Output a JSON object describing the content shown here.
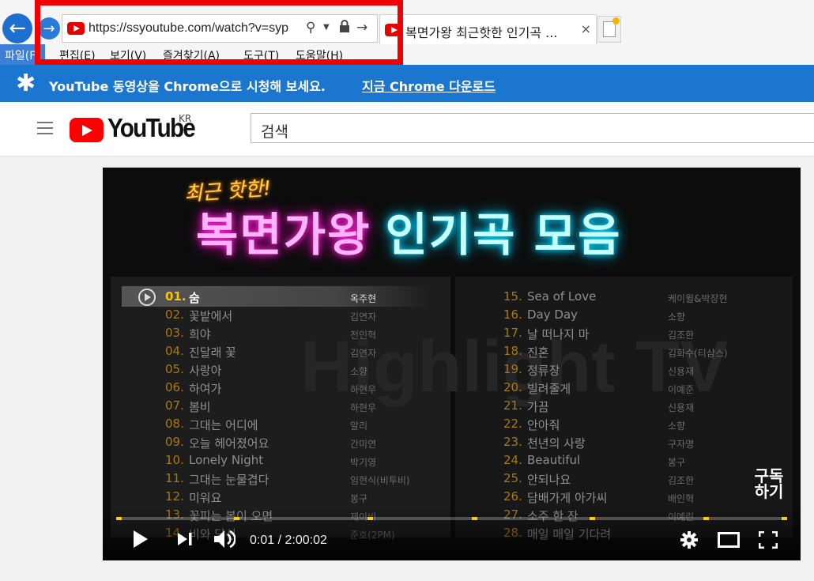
{
  "browser": {
    "address_url": "https://ssyoutube.com/watch?v=syp",
    "tab_title": "복면가왕 최근핫한 인기곡 ...",
    "tab_close": "×",
    "menu": [
      "파일(F)",
      "편집(E)",
      "보기(V)",
      "즐겨찾기(A)",
      "도구(T)",
      "도움말(H)"
    ]
  },
  "banner": {
    "text": "YouTube 동영상을 Chrome으로 시청해 보세요.",
    "link": "지금 Chrome 다운로드"
  },
  "youtube": {
    "logo": "YouTube",
    "region": "KR",
    "search_placeholder": "검색"
  },
  "video": {
    "title_small": "최근 핫한!",
    "title_a": "복면가왕",
    "title_b": "인기곡 모음",
    "watermark": "Highlight TV",
    "subscribe": "구독\n하기",
    "time": "0:01 / 2:00:02",
    "progress": 0.0001,
    "chapter_markers": [
      0.0,
      0.175,
      0.375,
      0.53,
      0.705,
      0.875,
      0.995
    ]
  },
  "songs_left": [
    {
      "num": "01.",
      "title": "숨",
      "artist": "옥주현"
    },
    {
      "num": "02.",
      "title": "꽃밭에서",
      "artist": "김연자"
    },
    {
      "num": "03.",
      "title": "희야",
      "artist": "전인혁"
    },
    {
      "num": "04.",
      "title": "진달래 꽃",
      "artist": "김연자"
    },
    {
      "num": "05.",
      "title": "사랑아",
      "artist": "소향"
    },
    {
      "num": "06.",
      "title": "하여가",
      "artist": "하현우"
    },
    {
      "num": "07.",
      "title": "봄비",
      "artist": "하현우"
    },
    {
      "num": "08.",
      "title": "그대는 어디에",
      "artist": "알리"
    },
    {
      "num": "09.",
      "title": "오늘 헤어졌어요",
      "artist": "간미연"
    },
    {
      "num": "10.",
      "title": "Lonely Night",
      "artist": "박기영"
    },
    {
      "num": "11.",
      "title": "그대는 눈물겹다",
      "artist": "임현식(비투비)"
    },
    {
      "num": "12.",
      "title": "미워요",
      "artist": "봉구"
    },
    {
      "num": "13.",
      "title": "꽃피는 봄이 오면",
      "artist": "제이비"
    },
    {
      "num": "14.",
      "title": "비와 당신",
      "artist": "준호(2PM)"
    }
  ],
  "songs_right": [
    {
      "num": "15.",
      "title": "Sea of Love",
      "artist": "케이윌&박장현"
    },
    {
      "num": "16.",
      "title": "Day Day",
      "artist": "소향"
    },
    {
      "num": "17.",
      "title": "날 떠나지 마",
      "artist": "김조한"
    },
    {
      "num": "18.",
      "title": "진혼",
      "artist": "김화수(티삼스)"
    },
    {
      "num": "19.",
      "title": "정류장",
      "artist": "신용재"
    },
    {
      "num": "20.",
      "title": "빌려줄게",
      "artist": "이예준"
    },
    {
      "num": "21.",
      "title": "가끔",
      "artist": "신용재"
    },
    {
      "num": "22.",
      "title": "안아줘",
      "artist": "소향"
    },
    {
      "num": "23.",
      "title": "천년의 사랑",
      "artist": "구자명"
    },
    {
      "num": "24.",
      "title": "Beautiful",
      "artist": "봉구"
    },
    {
      "num": "25.",
      "title": "안되나요",
      "artist": "김조한"
    },
    {
      "num": "26.",
      "title": "담배가게 아가씨",
      "artist": "배인혁"
    },
    {
      "num": "27.",
      "title": "소주 한 잔",
      "artist": "이예린"
    },
    {
      "num": "28.",
      "title": "매일 매일 기다려",
      "artist": ""
    }
  ],
  "colors": {
    "highlight_box": "#f00000",
    "banner": "#1b76d0",
    "youtube_red": "#ff0000",
    "chapter_marker": "#ffcc00"
  },
  "icons": [
    "back-arrow-icon",
    "forward-arrow-icon",
    "youtube-favicon-icon",
    "search-icon",
    "lock-icon",
    "go-arrow-icon",
    "new-tab-icon",
    "star-icon",
    "hamburger-menu-icon",
    "play-icon",
    "next-icon",
    "volume-icon",
    "settings-gear-icon",
    "theater-mode-icon",
    "fullscreen-icon"
  ]
}
